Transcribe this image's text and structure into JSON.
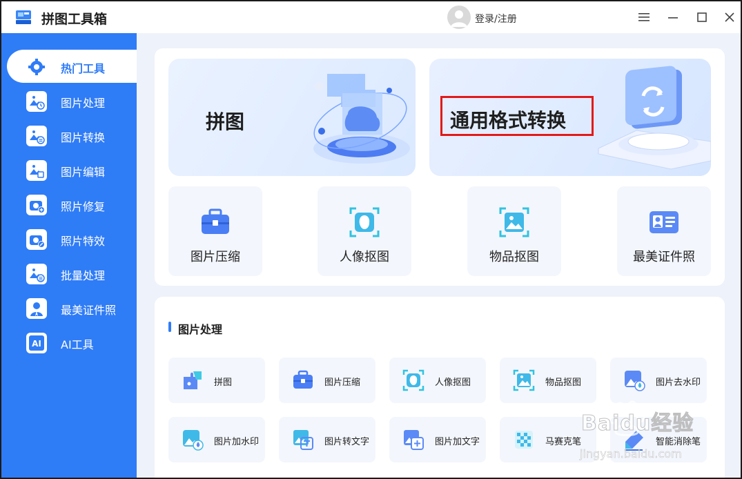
{
  "app": {
    "title": "拼图工具箱",
    "login_label": "登录/注册"
  },
  "sidebar": {
    "items": [
      {
        "label": "热门工具",
        "icon": "wrench-gear-icon",
        "active": true
      },
      {
        "label": "图片处理",
        "icon": "image-clock-icon"
      },
      {
        "label": "图片转换",
        "icon": "image-convert-icon"
      },
      {
        "label": "图片编辑",
        "icon": "image-edit-icon"
      },
      {
        "label": "照片修复",
        "icon": "camera-plus-icon"
      },
      {
        "label": "照片特效",
        "icon": "camera-magic-icon"
      },
      {
        "label": "批量处理",
        "icon": "image-batch-icon"
      },
      {
        "label": "最美证件照",
        "icon": "id-person-icon"
      },
      {
        "label": "AI工具",
        "icon": "ai-icon"
      }
    ]
  },
  "hot": {
    "banners": [
      {
        "label": "拼图"
      },
      {
        "label": "通用格式转换"
      }
    ],
    "tools": [
      {
        "label": "图片压缩"
      },
      {
        "label": "人像抠图"
      },
      {
        "label": "物品抠图"
      },
      {
        "label": "最美证件照"
      }
    ]
  },
  "image_processing": {
    "title": "图片处理",
    "tools": [
      {
        "label": "拼图"
      },
      {
        "label": "图片压缩"
      },
      {
        "label": "人像抠图"
      },
      {
        "label": "物品抠图"
      },
      {
        "label": "图片去水印"
      },
      {
        "label": "图片加水印"
      },
      {
        "label": "图片转文字"
      },
      {
        "label": "图片加文字"
      },
      {
        "label": "马赛克笔"
      },
      {
        "label": "智能消除笔"
      }
    ]
  },
  "watermark": {
    "text": "Baidu经验",
    "url_text": "jingyan.baidu.com"
  },
  "colors": {
    "accent": "#2f7cf7",
    "highlight": "#e11a1a"
  }
}
